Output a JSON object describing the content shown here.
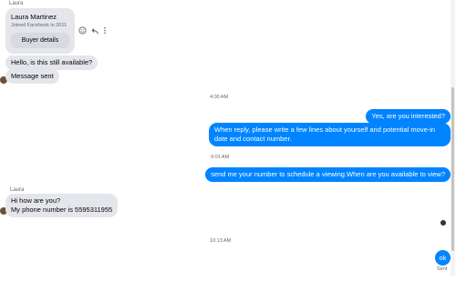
{
  "contact": {
    "sender_label": "Laura",
    "name": "Laura Martinez",
    "joined": "Joined Facebook in 2011",
    "buyer_details_label": "Buyer details"
  },
  "messages": {
    "m1": "Hello, is this still available?",
    "m2": "Message sent",
    "t1": "4:00 AM",
    "m3": "Yes, are you interested?",
    "m4": "When reply, please write a few lines about yourself and potential move-in date  and contact number.",
    "t2": "9:01 AM",
    "m5": "send me your number to schedule a viewing.When are you available to view?",
    "sender2": "Laura",
    "m6a": "Hi how are you?",
    "m6b": "My phone number is 5595311955",
    "t3": "10:13 AM",
    "m7": "ok",
    "status": "Sent"
  },
  "colors": {
    "outgoing": "#0084ff",
    "incoming": "#e4e6eb"
  },
  "icons": [
    "smiley-icon",
    "reply-icon",
    "more-icon"
  ]
}
